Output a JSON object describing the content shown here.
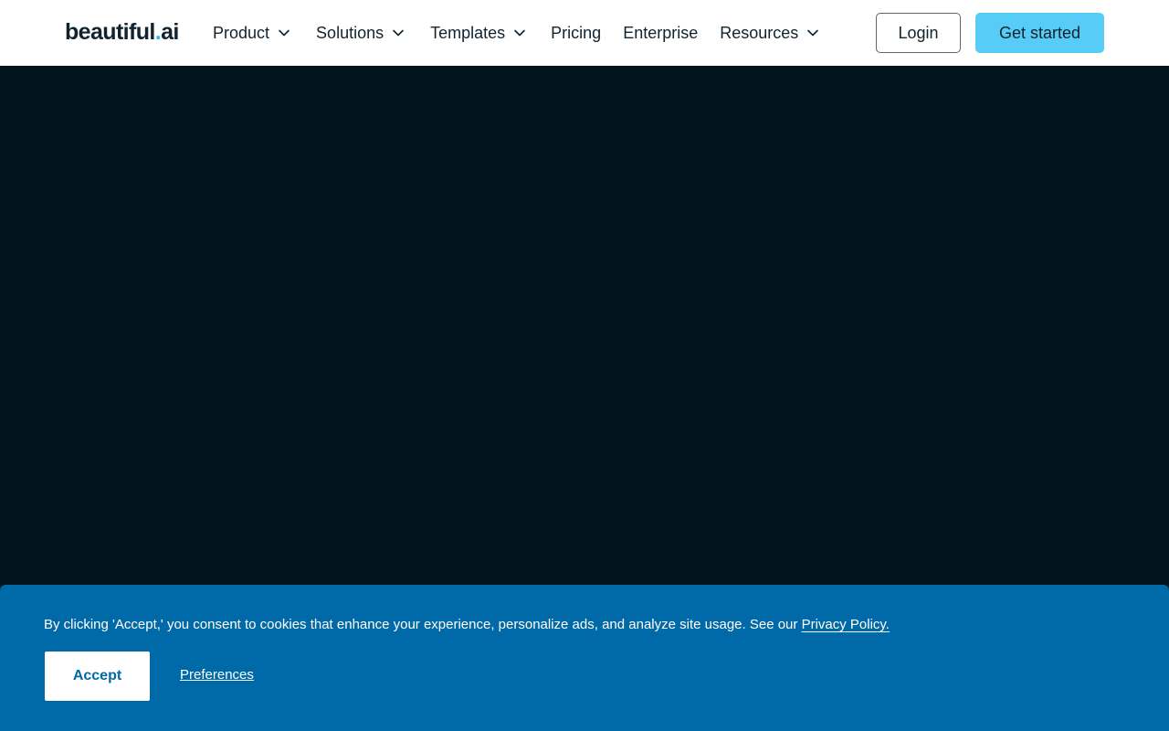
{
  "brand": {
    "logo_main": "beautiful",
    "logo_dot": ".",
    "logo_tld": "ai"
  },
  "nav": {
    "items": [
      {
        "label": "Product",
        "has_dropdown": true
      },
      {
        "label": "Solutions",
        "has_dropdown": true
      },
      {
        "label": "Templates",
        "has_dropdown": true
      },
      {
        "label": "Pricing",
        "has_dropdown": false
      },
      {
        "label": "Enterprise",
        "has_dropdown": false
      },
      {
        "label": "Resources",
        "has_dropdown": true
      }
    ],
    "login_label": "Login",
    "cta_label": "Get started"
  },
  "cookie_banner": {
    "message": "By clicking 'Accept,' you consent to cookies that enhance your experience, personalize ads, and analyze site usage. See our ",
    "policy_link": "Privacy Policy.",
    "accept_label": "Accept",
    "preferences_label": "Preferences"
  },
  "colors": {
    "nav_bg": "#ffffff",
    "hero_bg": "#02141d",
    "cta_bg": "#56ccf6",
    "banner_bg": "#0069a7",
    "logo_dot": "#2eb8f0"
  },
  "icons": {
    "dropdown": "chevron-down-icon"
  }
}
